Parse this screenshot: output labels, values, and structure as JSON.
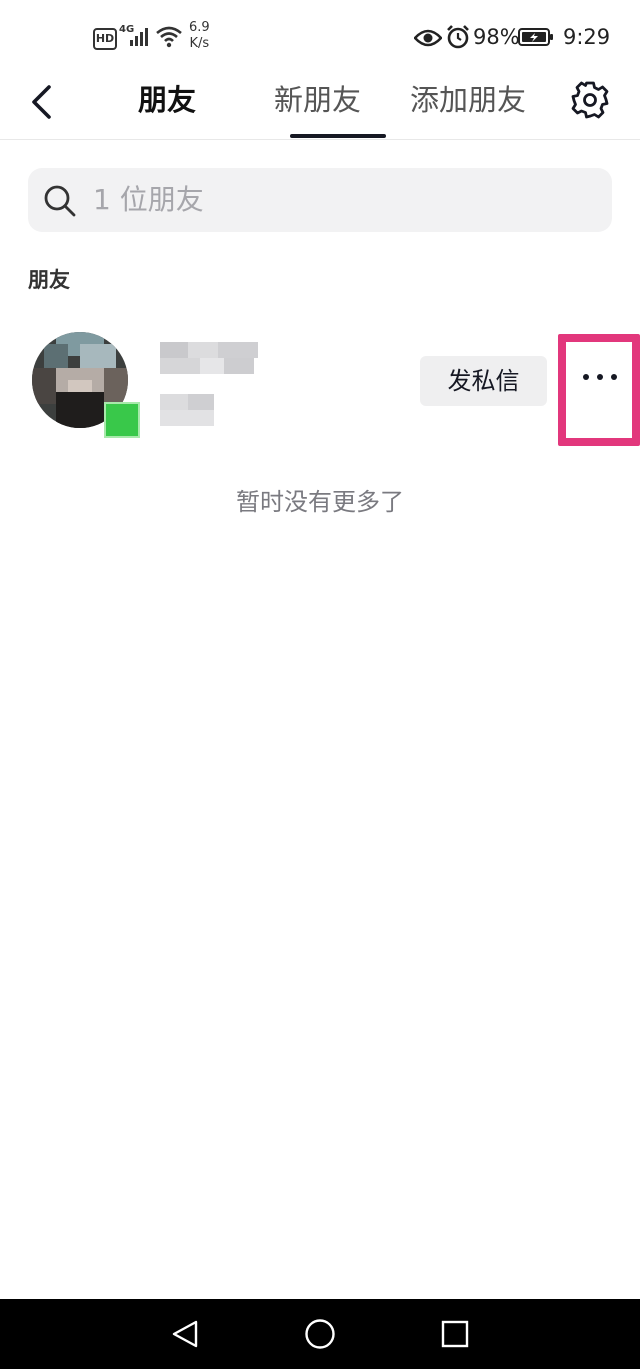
{
  "status_bar": {
    "hd": "HD",
    "network": "4G",
    "net_speed_value": "6.9",
    "net_speed_unit": "K/s",
    "battery": "98%",
    "time": "9:29",
    "icons": [
      "hd-icon",
      "signal-icon",
      "wifi-icon",
      "eye-icon",
      "alarm-icon",
      "battery-charging-icon"
    ]
  },
  "header": {
    "tabs": [
      {
        "label": "朋友",
        "active": true
      },
      {
        "label": "新朋友",
        "active": false
      },
      {
        "label": "添加朋友",
        "active": false
      }
    ],
    "back_icon": "back-arrow-icon",
    "settings_icon": "gear-icon"
  },
  "search": {
    "placeholder": "1 位朋友",
    "icon": "search-icon"
  },
  "section": {
    "title": "朋友"
  },
  "friends": [
    {
      "online": true,
      "message_button": "发私信",
      "more_icon": "more-dots-icon"
    }
  ],
  "list_footer": "暂时没有更多了",
  "colors": {
    "highlight_border": "#e2377c",
    "online": "#39c84a",
    "tab_underline": "#161823",
    "search_bg": "#f2f2f3"
  },
  "nav_bar": {
    "icons": [
      "nav-back-icon",
      "nav-home-icon",
      "nav-recent-icon"
    ]
  }
}
